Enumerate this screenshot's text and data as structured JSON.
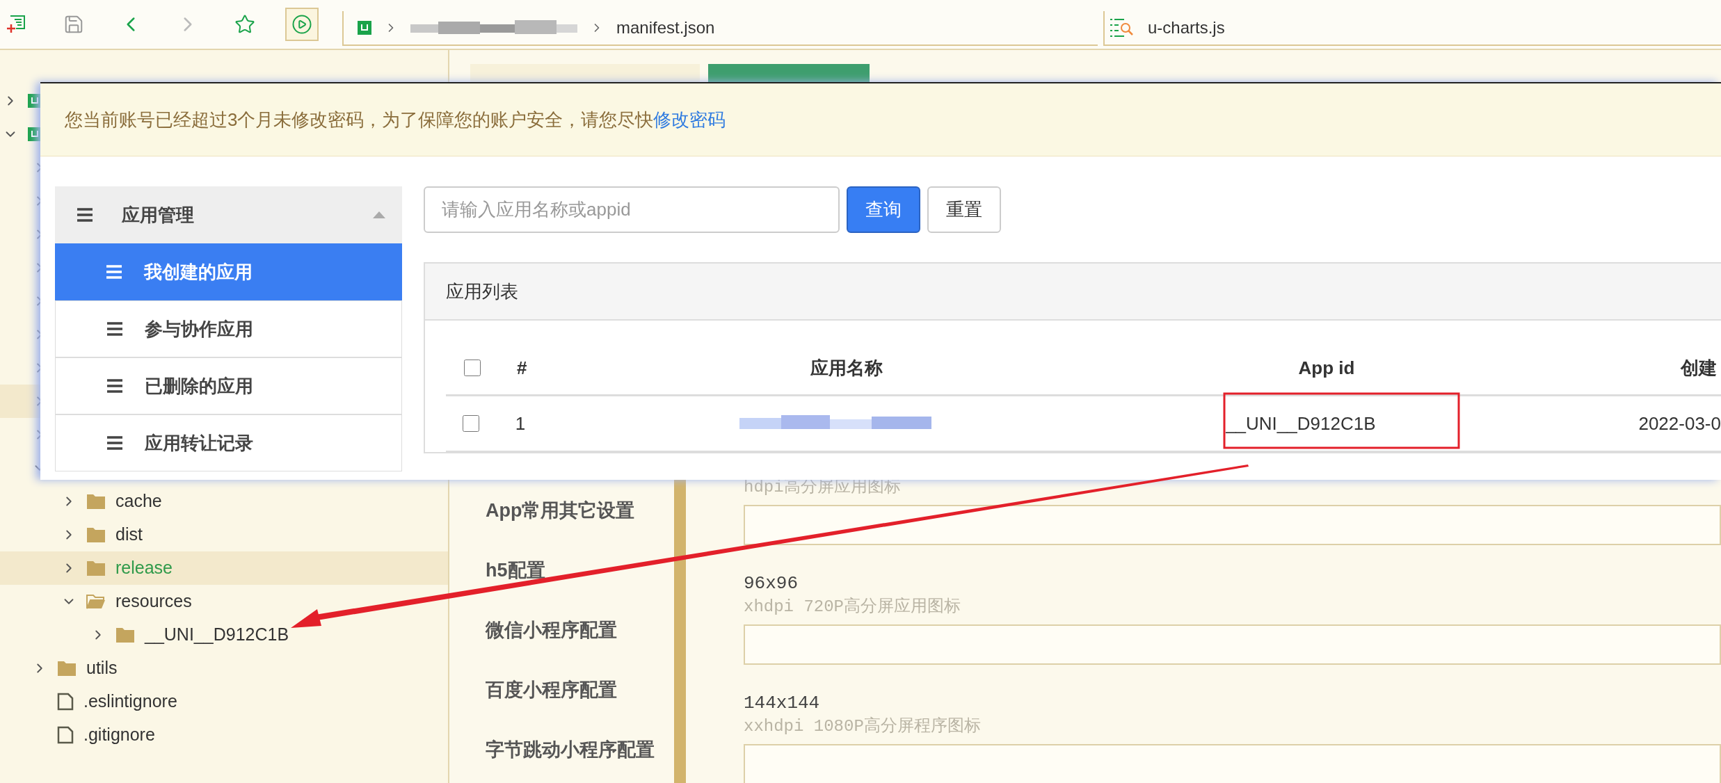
{
  "toolbar": {
    "breadcrumb_file": "manifest.json",
    "search_tab": "u-charts.js"
  },
  "editor_tabs": [
    {
      "selected": false
    },
    {
      "selected": true
    }
  ],
  "tree": [
    {
      "kind": "project",
      "expanded": false,
      "selected": false
    },
    {
      "kind": "project",
      "expanded": true,
      "selected": false,
      "children": [
        {
          "kind": "folder",
          "expanded": false,
          "selected": false
        },
        {
          "kind": "folder",
          "expanded": false,
          "selected": false
        },
        {
          "kind": "folder",
          "expanded": false,
          "selected": false
        },
        {
          "kind": "folder",
          "expanded": false,
          "selected": false
        },
        {
          "kind": "folder",
          "expanded": false,
          "selected": false
        },
        {
          "kind": "folder",
          "expanded": false,
          "selected": false
        },
        {
          "kind": "folder",
          "expanded": false,
          "selected": false
        },
        {
          "kind": "folder",
          "expanded": false,
          "selected": true
        },
        {
          "kind": "folder",
          "expanded": false,
          "selected": false
        },
        {
          "kind": "folder",
          "expanded": true,
          "selected": false,
          "children": [
            {
              "kind": "folder",
              "label": "cache",
              "expanded": false,
              "selected": false
            },
            {
              "kind": "folder",
              "label": "dist",
              "expanded": false,
              "selected": false
            },
            {
              "kind": "folder",
              "label": "release",
              "expanded": false,
              "selected": true
            },
            {
              "kind": "folder",
              "label": "resources",
              "expanded": true,
              "selected": false,
              "children": [
                {
                  "kind": "folder",
                  "label": "__UNI__D912C1B",
                  "expanded": false,
                  "selected": false
                }
              ]
            }
          ]
        },
        {
          "kind": "folder",
          "label": "utils",
          "expanded": false,
          "selected": false
        },
        {
          "kind": "file",
          "label": ".eslintignore",
          "selected": false
        },
        {
          "kind": "file",
          "label": ".gitignore",
          "selected": false
        }
      ]
    }
  ],
  "settings_nav": [
    "App常用其它设置",
    "h5配置",
    "微信小程序配置",
    "百度小程序配置",
    "字节跳动小程序配置"
  ],
  "icon_fields": [
    {
      "hint": "hdpi高分屏应用图标"
    },
    {
      "size": "96x96",
      "hint": "xhdpi 720P高分屏应用图标"
    },
    {
      "size": "144x144",
      "hint": "xxhdpi 1080P高分屏程序图标"
    }
  ],
  "dialog": {
    "notice": "您当前账号已经超过3个月未修改密码，为了保障您的账户安全，请您尽快",
    "notice_link": "修改密码",
    "menu": {
      "title": "应用管理",
      "expanded": true,
      "items": [
        {
          "label": "我创建的应用",
          "selected": true
        },
        {
          "label": "参与协作应用",
          "selected": false
        },
        {
          "label": "已删除的应用",
          "selected": false
        },
        {
          "label": "应用转让记录",
          "selected": false
        }
      ]
    },
    "search": {
      "placeholder": "请输入应用名称或appid"
    },
    "buttons": [
      {
        "label": "查询",
        "kind": "primary"
      },
      {
        "label": "重置",
        "kind": "default"
      }
    ],
    "panel_title": "应用列表",
    "table": {
      "header_checked": false,
      "columns": [
        "#",
        "应用名称",
        "App id",
        "创建"
      ],
      "rows": [
        {
          "checked": false,
          "index": "1",
          "app_id": "__UNI__D912C1B",
          "created": "2022-03-0",
          "highlighted": true
        }
      ]
    }
  }
}
